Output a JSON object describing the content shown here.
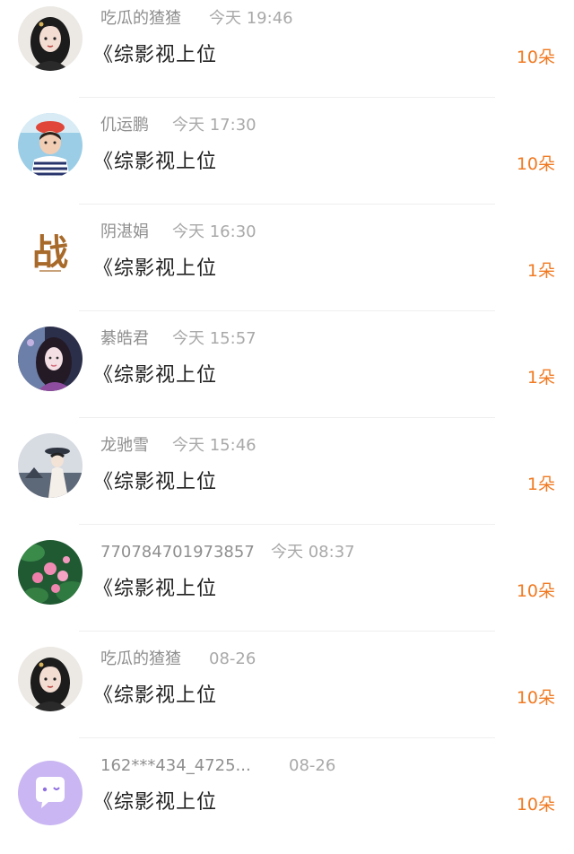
{
  "messages": [
    {
      "user": "吃瓜的猹猹",
      "time": "今天 19:46",
      "title": "《综影视上位",
      "count": "10朵",
      "avatar_icon": "anime-girl-portrait-icon"
    },
    {
      "user": "仉运鹏",
      "time": "今天 17:30",
      "title": "《综影视上位",
      "count": "10朵",
      "avatar_icon": "child-photo-icon"
    },
    {
      "user": "阴湛娟",
      "time": "今天 16:30",
      "title": "《综影视上位",
      "count": "1朵",
      "avatar_icon": "calligraphy-character-icon"
    },
    {
      "user": "綦皓君",
      "time": "今天 15:57",
      "title": "《综影视上位",
      "count": "1朵",
      "avatar_icon": "fantasy-girl-portrait-icon"
    },
    {
      "user": "龙驰雪",
      "time": "今天 15:46",
      "title": "《综影视上位",
      "count": "1朵",
      "avatar_icon": "ancient-style-figure-icon"
    },
    {
      "user": "770784701973857",
      "time": "今天 08:37",
      "title": "《综影视上位",
      "count": "10朵",
      "avatar_icon": "lotus-pond-icon"
    },
    {
      "user": "吃瓜的猹猹",
      "time": "08-26",
      "title": "《综影视上位",
      "count": "10朵",
      "avatar_icon": "anime-girl-portrait-icon"
    },
    {
      "user": "162***434_4725...",
      "time": "08-26",
      "title": "《综影视上位",
      "count": "10朵",
      "avatar_icon": "default-chat-bubble-icon"
    }
  ],
  "colors": {
    "accent": "#f07a22",
    "username": "#8f8f8f",
    "time": "#a9a9a9",
    "title": "#222222"
  }
}
